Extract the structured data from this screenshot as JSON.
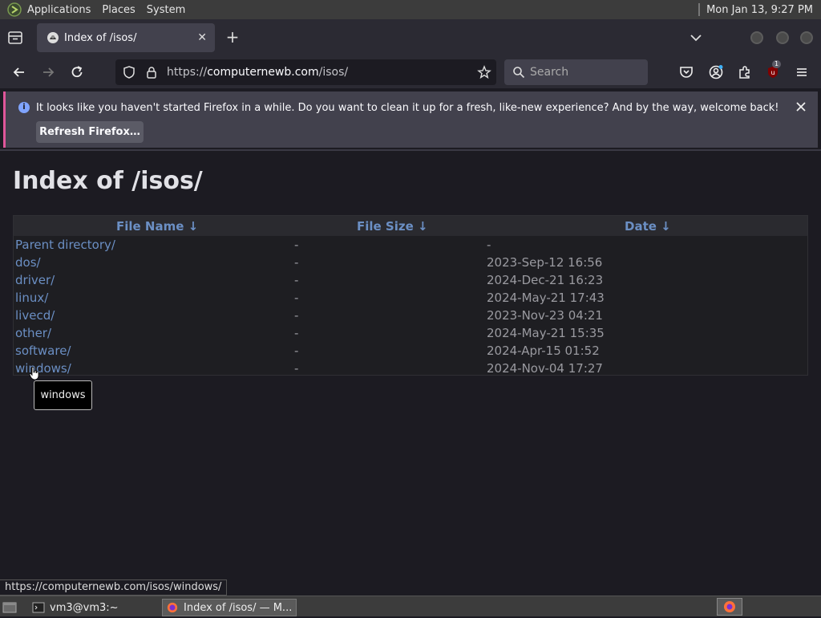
{
  "system_panel": {
    "menus": [
      "Applications",
      "Places",
      "System"
    ],
    "clock": "Mon Jan 13,  9:27 PM"
  },
  "browser": {
    "tab": {
      "title": "Index of /isos/"
    },
    "url": {
      "prefix": "https://",
      "host": "computernewb.com",
      "path": "/isos/"
    },
    "search": {
      "placeholder": "Search"
    },
    "extension_badge": "1"
  },
  "notification": {
    "message": "It looks like you haven't started Firefox in a while. Do you want to clean it up for a fresh, like-new experience? And by the way, welcome back!",
    "button": "Refresh Firefox…"
  },
  "page": {
    "title": "Index of /isos/",
    "columns": [
      "File Name  ↓",
      "File Size  ↓",
      "Date  ↓"
    ],
    "rows": [
      {
        "name": "Parent directory/",
        "size": "-",
        "date": "-"
      },
      {
        "name": "dos/",
        "size": "-",
        "date": "2023-Sep-12 16:56"
      },
      {
        "name": "driver/",
        "size": "-",
        "date": "2024-Dec-21 16:23"
      },
      {
        "name": "linux/",
        "size": "-",
        "date": "2024-May-21 17:43"
      },
      {
        "name": "livecd/",
        "size": "-",
        "date": "2023-Nov-23 04:21"
      },
      {
        "name": "other/",
        "size": "-",
        "date": "2024-May-21 15:35"
      },
      {
        "name": "software/",
        "size": "-",
        "date": "2024-Apr-15 01:52"
      },
      {
        "name": "windows/",
        "size": "-",
        "date": "2024-Nov-04 17:27"
      }
    ]
  },
  "tooltip": "windows",
  "status_url": "https://computernewb.com/isos/windows/",
  "taskbar": {
    "items": [
      "vm3@vm3:~",
      "Index of /isos/ — M..."
    ]
  }
}
